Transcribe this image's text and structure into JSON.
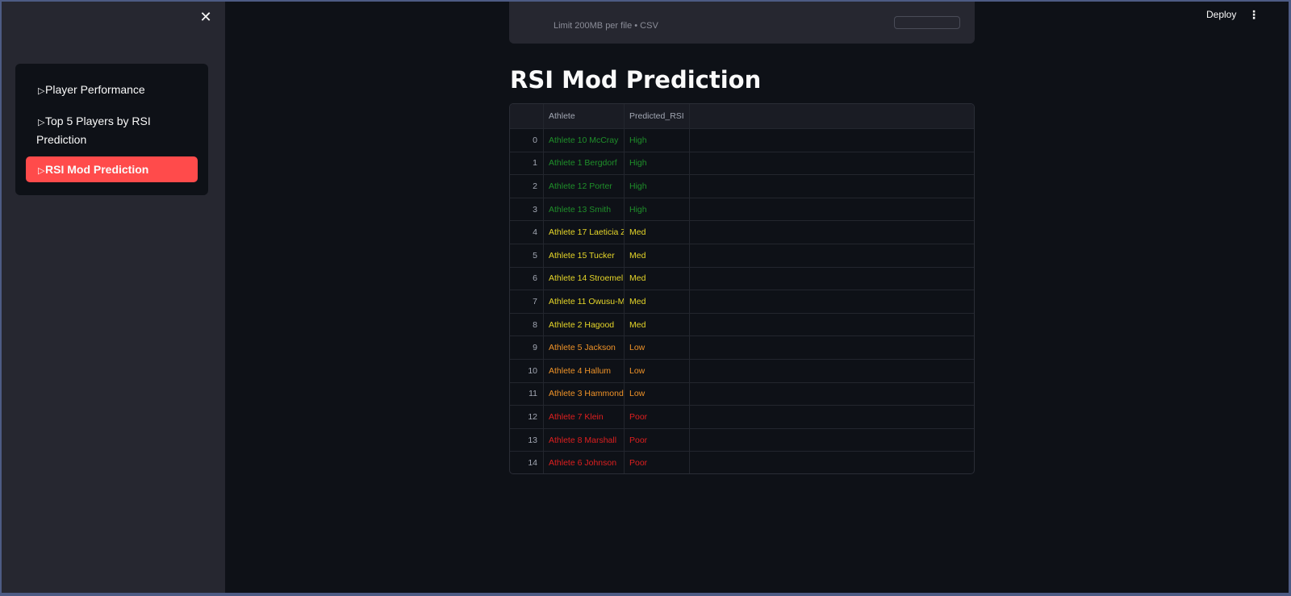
{
  "sidebar": {
    "close": "✕",
    "items": [
      {
        "label": "Player Performance",
        "active": false
      },
      {
        "label_line1": "Top 5 Players by RSI",
        "label_line2": "Prediction",
        "active": false
      },
      {
        "label": "RSI Mod Prediction",
        "active": true
      }
    ],
    "triangle": "▷",
    "accent": "#ff4b4b"
  },
  "header": {
    "deploy": "Deploy",
    "menu": "⋮"
  },
  "uploader": {
    "limit_text": "Limit 200MB per file • CSV"
  },
  "main": {
    "title": "RSI Mod Prediction"
  },
  "table": {
    "columns": [
      "",
      "Athlete",
      "Predicted_RSI"
    ],
    "colors": {
      "High": "#1f8f2a",
      "Med": "#e6d629",
      "Low": "#f09328",
      "Poor": "#e01f1f"
    },
    "rows": [
      {
        "idx": "0",
        "athlete": "Athlete 10 McCray",
        "rsi": "High"
      },
      {
        "idx": "1",
        "athlete": "Athlete 1 Bergdorf",
        "rsi": "High"
      },
      {
        "idx": "2",
        "athlete": "Athlete 12 Porter",
        "rsi": "High"
      },
      {
        "idx": "3",
        "athlete": "Athlete 13 Smith",
        "rsi": "High"
      },
      {
        "idx": "4",
        "athlete": "Athlete 17 Laeticia Z",
        "rsi": "Med"
      },
      {
        "idx": "5",
        "athlete": "Athlete 15 Tucker",
        "rsi": "Med"
      },
      {
        "idx": "6",
        "athlete": "Athlete 14 Stroemel",
        "rsi": "Med"
      },
      {
        "idx": "7",
        "athlete": "Athlete 11 Owusu-M",
        "rsi": "Med"
      },
      {
        "idx": "8",
        "athlete": "Athlete 2 Hagood",
        "rsi": "Med"
      },
      {
        "idx": "9",
        "athlete": "Athlete 5 Jackson",
        "rsi": "Low"
      },
      {
        "idx": "10",
        "athlete": "Athlete 4 Hallum",
        "rsi": "Low"
      },
      {
        "idx": "11",
        "athlete": "Athlete 3 Hammond",
        "rsi": "Low"
      },
      {
        "idx": "12",
        "athlete": "Athlete 7 Klein",
        "rsi": "Poor"
      },
      {
        "idx": "13",
        "athlete": "Athlete 8 Marshall",
        "rsi": "Poor"
      },
      {
        "idx": "14",
        "athlete": "Athlete 6 Johnson",
        "rsi": "Poor"
      }
    ]
  }
}
